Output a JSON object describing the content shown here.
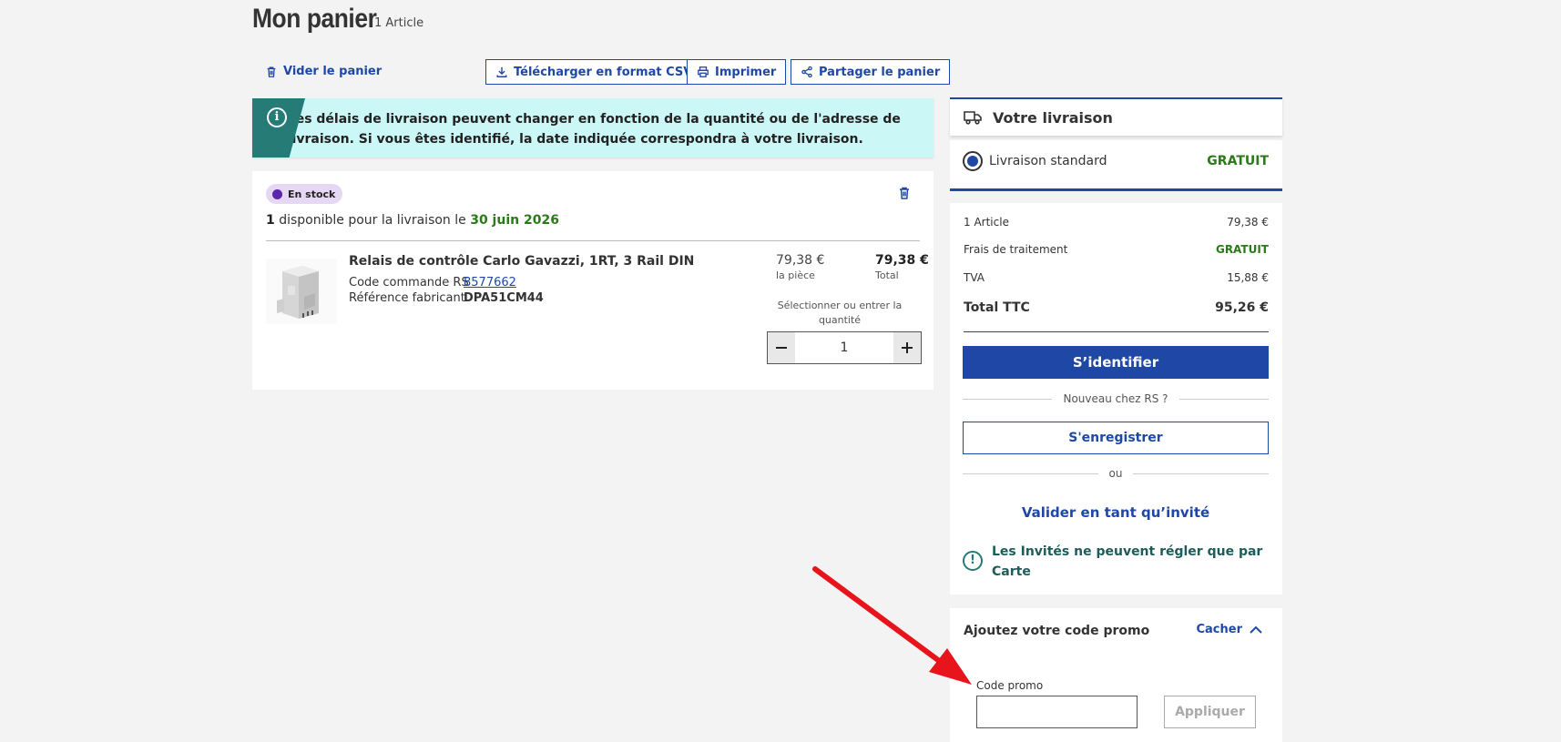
{
  "header": {
    "title": "Mon panier",
    "count": "1 Article"
  },
  "actions": {
    "empty_cart": "Vider le panier",
    "download_csv": "Télécharger en format CSV",
    "print": "Imprimer",
    "share": "Partager le panier"
  },
  "info_banner": {
    "text": "Les délais de livraison peuvent changer en fonction de la quantité ou de l'adresse de livraison. Si vous êtes identifié, la date indiquée correspondra à votre livraison."
  },
  "item_group": {
    "stock_badge": "En stock",
    "available_qty": "1",
    "available_text": " disponible pour la livraison le ",
    "delivery_date": "30 juin 2026",
    "product": {
      "name": "Relais de contrôle Carlo Gavazzi, 1RT, 3 Rail DIN",
      "order_code_label": "Code commande RS",
      "order_code": "8577662",
      "mfr_ref_label": "Référence fabricant",
      "mfr_ref": "DPA51CM44",
      "unit_price": "79,38 €",
      "unit_price_label": "la pièce",
      "total_price": "79,38 €",
      "total_label": "Total",
      "qty_label": "Sélectionner ou entrer la quantité",
      "quantity": "1"
    }
  },
  "delivery": {
    "title": "Votre livraison",
    "option_label": "Livraison standard",
    "option_price": "GRATUIT"
  },
  "summary": {
    "items_label": "1 Article",
    "items_value": "79,38 €",
    "handling_label": "Frais de traitement",
    "handling_value": "GRATUIT",
    "vat_label": "TVA",
    "vat_value": "15,88 €",
    "total_label": "Total TTC",
    "total_value": "95,26 €",
    "login_button": "S’identifier",
    "new_customer": "Nouveau chez RS ?",
    "register_button": "S'enregistrer",
    "or": "ou",
    "guest_checkout": "Valider en tant qu’invité",
    "guest_warning": "Les Invités ne peuvent régler que par Carte"
  },
  "promo": {
    "title": "Ajoutez votre code promo",
    "hide": "Cacher",
    "field_label": "Code promo",
    "field_value": "",
    "apply_button": "Appliquer"
  },
  "colors": {
    "brand_blue": "#1f48a6",
    "teal": "#267b77",
    "info_bg": "#cbf7f7",
    "green": "#2b7a1a",
    "annotation_arrow": "#e8141b"
  }
}
